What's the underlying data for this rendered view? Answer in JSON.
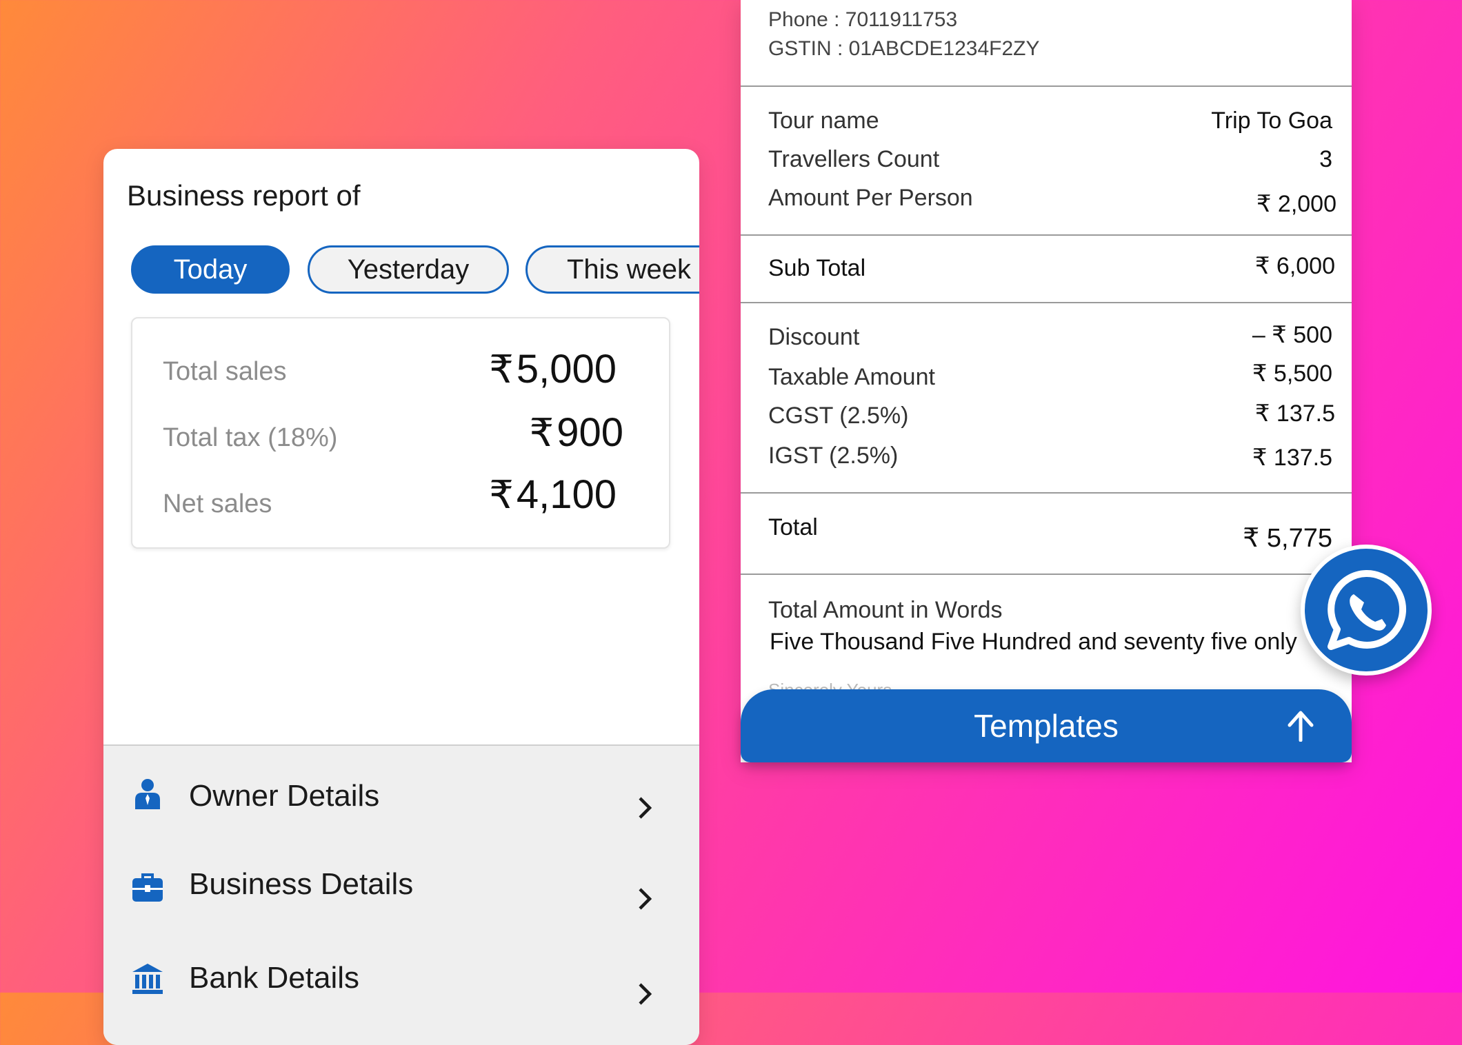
{
  "report": {
    "title": "Business report of",
    "tabs": [
      {
        "label": "Today",
        "active": true
      },
      {
        "label": "Yesterday",
        "active": false
      },
      {
        "label": "This week",
        "active": false
      }
    ],
    "summary": [
      {
        "label": "Total sales",
        "currency": "₹",
        "value": "5,000"
      },
      {
        "label": "Total tax (18%)",
        "currency": "₹",
        "value": "900"
      },
      {
        "label": "Net sales",
        "currency": "₹",
        "value": "4,100"
      }
    ],
    "menu": [
      {
        "label": "Owner Details",
        "icon": "person-icon"
      },
      {
        "label": "Business Details",
        "icon": "briefcase-icon"
      },
      {
        "label": "Bank Details",
        "icon": "bank-icon"
      }
    ]
  },
  "invoice": {
    "phone": "Phone : 7011911753",
    "gstin": "GSTIN : 01ABCDE1234F2ZY",
    "tour_name_label": "Tour name",
    "tour_name_value": "Trip To Goa",
    "travellers_label": "Travellers Count",
    "travellers_value": "3",
    "per_person_label": "Amount Per Person",
    "per_person_value": "₹ 2,000",
    "subtotal_label": "Sub Total",
    "subtotal_value": "₹ 6,000",
    "discount_label": "Discount",
    "discount_value": "–  ₹ 500",
    "taxable_label": "Taxable Amount",
    "taxable_value": "₹ 5,500",
    "cgst_label": "CGST (2.5%)",
    "cgst_value": "₹ 137.5",
    "igst_label": "IGST (2.5%)",
    "igst_value": "₹ 137.5",
    "total_label": "Total",
    "total_value": "₹ 5,775",
    "words_label": "Total  Amount in Words",
    "words_value": "Five Thousand Five Hundred and seventy five only",
    "faded_text": "Sincerely Yours"
  },
  "templates": {
    "label": "Templates",
    "icon": "arrow-up-icon"
  },
  "share": {
    "icon": "whatsapp-icon"
  },
  "colors": {
    "accent": "#1565c0",
    "panel": "#ffffff",
    "menu_bg": "#efefef"
  }
}
